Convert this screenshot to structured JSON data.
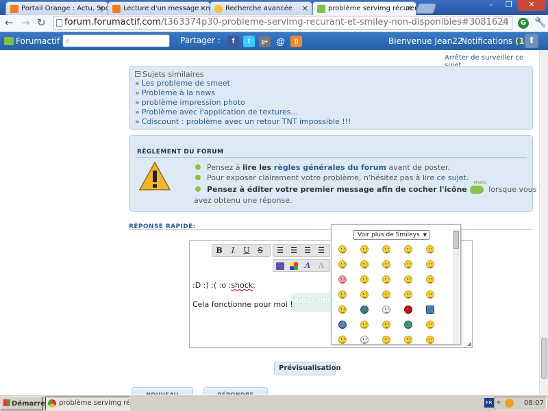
{
  "browser": {
    "tabs": [
      {
        "label": "Portail Orange : Actu, Sport, ...",
        "color": "#f47b20"
      },
      {
        "label": "Lecture d'un message - mail ...",
        "color": "#f47b20"
      },
      {
        "label": "Recherche avancée",
        "color": "#f2c230"
      },
      {
        "label": "problème servimg récurent e...",
        "color": "#7ec14c"
      }
    ],
    "url_domain": "forum.forumactif.com",
    "url_path": "/t363374p30-probleme-servimg-recurant-et-smiley-non-disponibles#3081624"
  },
  "forumbar": {
    "name": "Forumactif",
    "search_placeholder": "",
    "share_label": "Partager :",
    "welcome": "Bienvenue Jean22",
    "notifications_label": "Notifications",
    "notifications_count": "(1)"
  },
  "page": {
    "unwatch": "Arrêter de surveiller ce sujet",
    "similar": {
      "title": "Sujets similaires",
      "links": [
        "Les probleme de smeet",
        "Problème à la news",
        "problème impression photo",
        "Problème avec l'application de textures...",
        "Cdiscount : problème avec un retour TNT impossible !!!"
      ]
    },
    "rules": {
      "title": "RÈGLEMENT DU FORUM",
      "item1_pre": "Pensez à ",
      "item1_bold": "lire les ",
      "item1_link": "règles générales du forum",
      "item1_post": " avant de poster.",
      "item2_pre": "Pour exposer clairement votre problème, n'hésitez pas à lire ",
      "item2_link": "ce sujet",
      "item2_post": ".",
      "item3_bold": "Pensez à éditer votre premier message afin de cocher l'icône",
      "item3_icon_label": "résolu",
      "item3_post": " lorsque vous",
      "item3_cont": "avez obtenu une réponse."
    },
    "reply": {
      "title": "RÉPONSE RAPIDE:",
      "smiley_line_pre": ":D :) :( :o :",
      "smiley_line_shock": "shock",
      "smiley_line_post": ":",
      "message": "Cela fonctionne pour moi !",
      "watermark": "Aidez-mo",
      "more_smileys": "Voir plus de Smileys",
      "preview_button": "Prévisualisation",
      "new_button": "NOUVEAU",
      "reply_button": "RÉPONDRE"
    }
  },
  "taskbar": {
    "start": "Démarrer",
    "window": "problème servimg ré...",
    "lang": "FR",
    "time": "08:07"
  }
}
